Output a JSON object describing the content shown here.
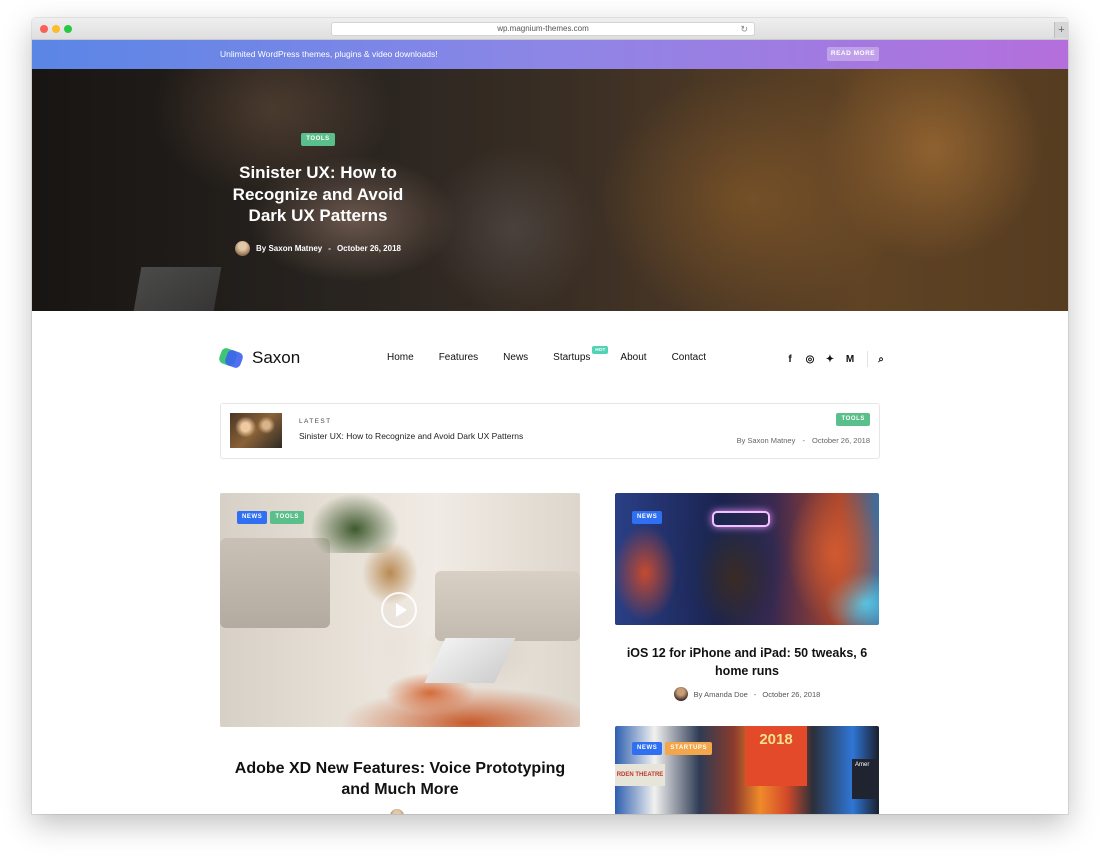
{
  "browser": {
    "url": "wp.magnium-themes.com",
    "reload_glyph": "↻",
    "newtab_glyph": "+"
  },
  "promo": {
    "text": "Unlimited WordPress themes, plugins & video downloads!",
    "button": "READ MORE"
  },
  "hero": {
    "tag": "TOOLS",
    "title": "Sinister UX: How to Recognize and Avoid Dark UX Patterns",
    "author": "By Saxon Matney",
    "separator": "-",
    "date": "October 26, 2018"
  },
  "site": {
    "logo_text": "Saxon"
  },
  "nav": {
    "items": [
      {
        "label": "Home"
      },
      {
        "label": "Features"
      },
      {
        "label": "News"
      },
      {
        "label": "Startups",
        "badge": "HOT"
      },
      {
        "label": "About"
      },
      {
        "label": "Contact"
      }
    ]
  },
  "social": {
    "icons": [
      {
        "name": "facebook-icon",
        "glyph": "f"
      },
      {
        "name": "instagram-icon",
        "glyph": "◎"
      },
      {
        "name": "twitter-icon",
        "glyph": "✦"
      },
      {
        "name": "medium-icon",
        "glyph": "M"
      }
    ],
    "search_glyph": "⌕"
  },
  "latest": {
    "label": "LATEST",
    "title": "Sinister UX: How to Recognize and Avoid Dark UX Patterns",
    "tag": "TOOLS",
    "author": "By Saxon Matney",
    "separator": "-",
    "date": "October 26, 2018"
  },
  "cards": {
    "main": {
      "tags": [
        "NEWS",
        "TOOLS"
      ],
      "title": "Adobe XD New Features: Voice Prototyping and Much More"
    },
    "ios": {
      "tags": [
        "NEWS"
      ],
      "title": "iOS 12 for iPhone and iPad: 50 tweaks, 6 home runs",
      "author": "By Amanda Doe",
      "separator": "-",
      "date": "October 26, 2018"
    },
    "city": {
      "tags": [
        "NEWS",
        "STARTUPS"
      ],
      "sign_text": "2018",
      "sign2_text": "RDEN THEATRE",
      "sign3_text": "Amer"
    }
  },
  "colors": {
    "tools_tag": "#5bbf8b",
    "news_tag": "#2f6ff2",
    "startups_tag": "#f3a64a",
    "hot_badge": "#52d3b5",
    "promo_start": "#5a86e6",
    "promo_end": "#b46fdc"
  }
}
